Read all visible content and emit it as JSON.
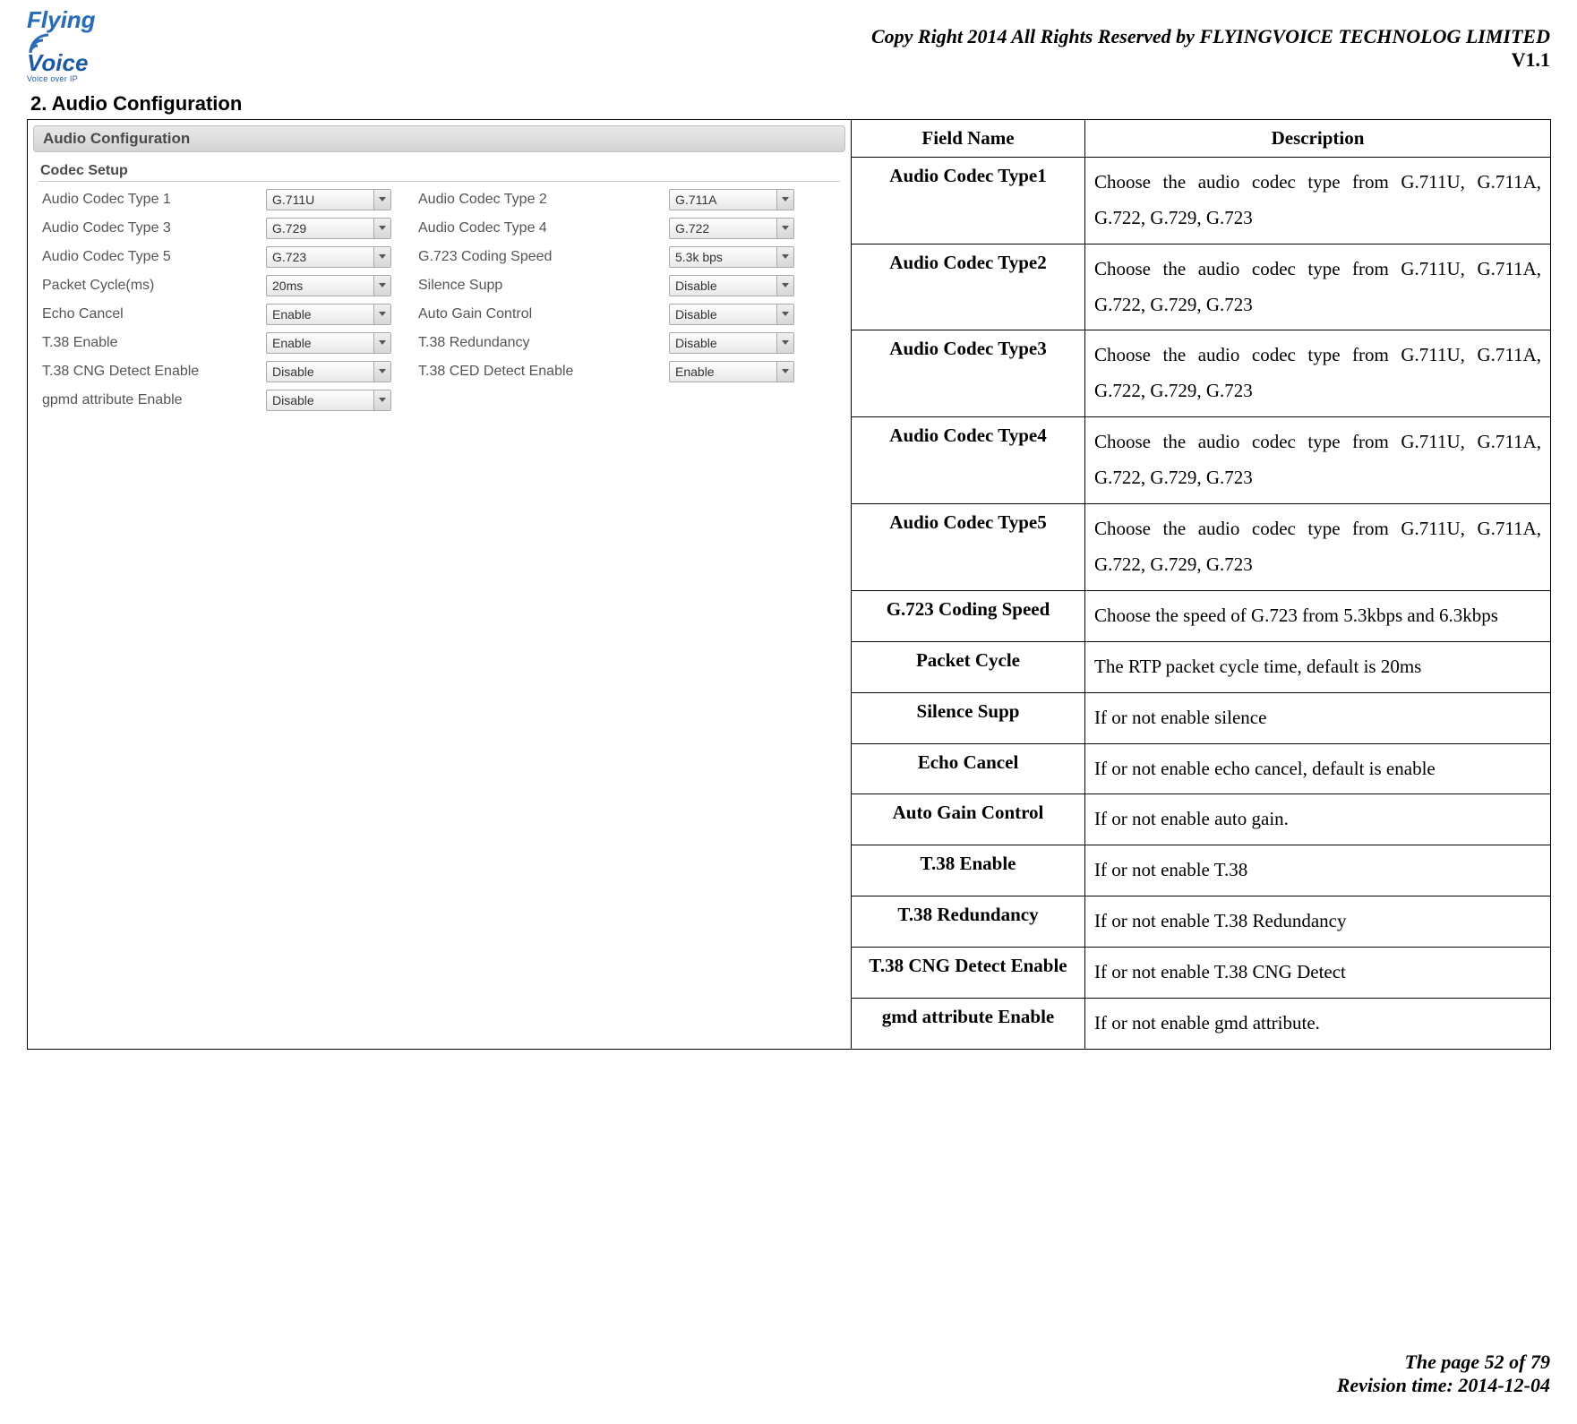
{
  "header": {
    "logo_top": "Flying",
    "logo_bottom": "Voice",
    "logo_tag": "Voice over IP",
    "copyright": "Copy Right 2014 All Rights Reserved by FLYINGVOICE TECHNOLOG LIMITED",
    "version": "V1.1"
  },
  "section": {
    "number_title": "2.  Audio Configuration"
  },
  "screenshot": {
    "title": "Audio Configuration",
    "group": "Codec Setup",
    "rows": [
      {
        "l1": "Audio Codec Type 1",
        "v1": "G.711U",
        "l2": "Audio Codec Type 2",
        "v2": "G.711A"
      },
      {
        "l1": "Audio Codec Type 3",
        "v1": "G.729",
        "l2": "Audio Codec Type 4",
        "v2": "G.722"
      },
      {
        "l1": "Audio Codec Type 5",
        "v1": "G.723",
        "l2": "G.723 Coding Speed",
        "v2": "5.3k bps"
      },
      {
        "l1": "Packet Cycle(ms)",
        "v1": "20ms",
        "l2": "Silence Supp",
        "v2": "Disable"
      },
      {
        "l1": "Echo Cancel",
        "v1": "Enable",
        "l2": "Auto Gain Control",
        "v2": "Disable"
      },
      {
        "l1": "T.38 Enable",
        "v1": "Enable",
        "l2": "T.38 Redundancy",
        "v2": "Disable"
      },
      {
        "l1": "T.38 CNG Detect Enable",
        "v1": "Disable",
        "l2": "T.38 CED Detect Enable",
        "v2": "Enable"
      },
      {
        "l1": "gpmd attribute Enable",
        "v1": "Disable",
        "l2": "",
        "v2": ""
      }
    ]
  },
  "desc_table": {
    "headers": {
      "field": "Field Name",
      "desc": "Description"
    },
    "rows": [
      {
        "field": "Audio Codec Type1",
        "desc": "Choose the audio codec type from G.711U, G.711A, G.722, G.729, G.723",
        "justify": true
      },
      {
        "field": "Audio Codec Type2",
        "desc": "Choose the audio codec type from G.711U, G.711A, G.722, G.729, G.723",
        "justify": true
      },
      {
        "field": "Audio Codec Type3",
        "desc": "Choose the audio codec type from G.711U, G.711A, G.722, G.729, G.723",
        "justify": true
      },
      {
        "field": "Audio Codec Type4",
        "desc": "Choose the audio codec type from G.711U, G.711A, G.722, G.729, G.723",
        "justify": true
      },
      {
        "field": "Audio Codec Type5",
        "desc": "Choose the audio codec type from G.711U, G.711A, G.722, G.729, G.723",
        "justify": true
      },
      {
        "field": "G.723 Coding Speed",
        "desc": "Choose the speed of G.723 from 5.3kbps and 6.3kbps",
        "justify": true
      },
      {
        "field": "Packet Cycle",
        "desc": "The RTP packet cycle time, default is 20ms"
      },
      {
        "field": "Silence Supp",
        "desc": "If or not enable silence"
      },
      {
        "field": "Echo Cancel",
        "desc": "If or not enable echo cancel, default is enable"
      },
      {
        "field": "Auto Gain Control",
        "desc": "If or not enable auto gain."
      },
      {
        "field": "T.38 Enable",
        "desc": "If or not enable T.38"
      },
      {
        "field": "T.38 Redundancy",
        "desc": "If or not enable T.38 Redundancy"
      },
      {
        "field": "T.38 CNG Detect Enable",
        "desc": "If or not enable T.38 CNG Detect"
      },
      {
        "field": "gmd attribute Enable",
        "desc": "If or not enable gmd attribute."
      }
    ]
  },
  "footer": {
    "page": "The page 52 of 79",
    "revision": "Revision time: 2014-12-04"
  }
}
